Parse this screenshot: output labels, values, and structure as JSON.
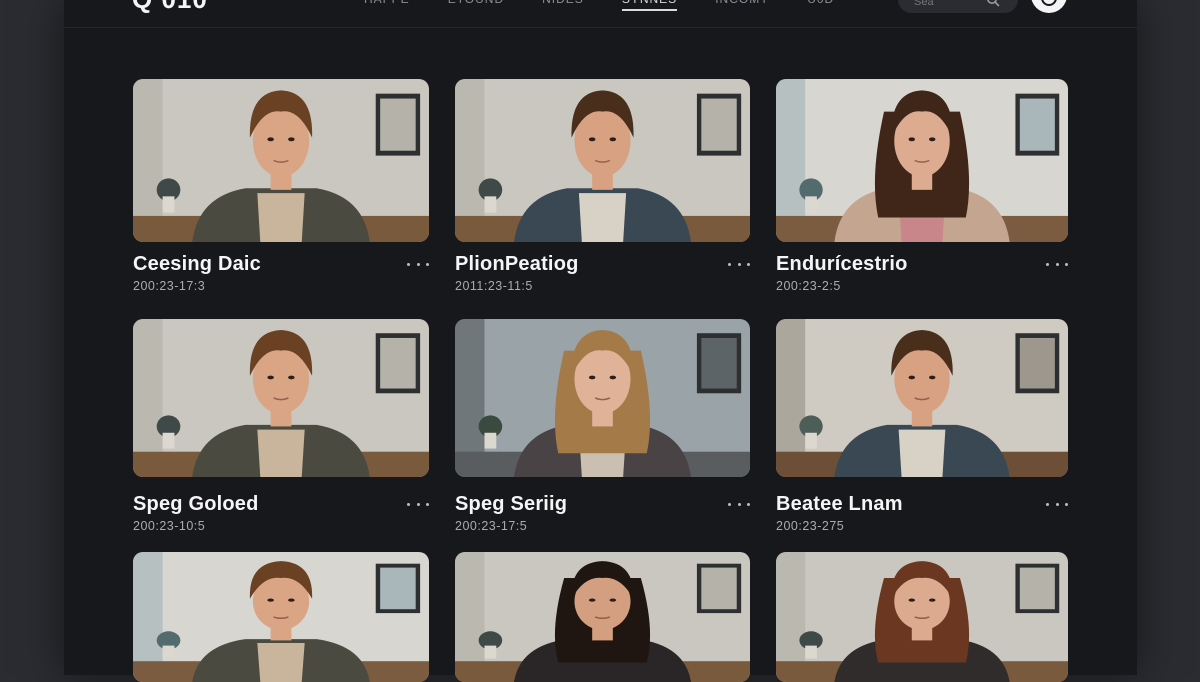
{
  "header": {
    "logo_text": "Q 010",
    "nav": [
      "HAPPE",
      "ETOUND",
      "NIDES",
      "SYNNES",
      "INCOMY",
      "U0D"
    ],
    "active_nav_index": 3,
    "search_placeholder": "Sea",
    "accent_color": "#f4f4f4"
  },
  "cards": [
    {
      "title": "Ceesing Daic",
      "date": "200:23-17:3",
      "person": "man-curly",
      "setting": "office"
    },
    {
      "title": "PlionPeatiog",
      "date": "2011:23-11:5",
      "person": "man-short",
      "setting": "office"
    },
    {
      "title": "Endurícestrio",
      "date": "200:23-2:5",
      "person": "woman-long",
      "setting": "window"
    },
    {
      "title": "Speg Goloed",
      "date": "200:23-10:5",
      "person": "man-curly",
      "setting": "office"
    },
    {
      "title": "Speg Seriig",
      "date": "200:23-17:5",
      "person": "woman-blonde",
      "setting": "street"
    },
    {
      "title": "Beatee Lnam",
      "date": "200:23-275",
      "person": "man-short",
      "setting": "cafe"
    },
    {
      "title": "",
      "date": "",
      "person": "man-curly",
      "setting": "window"
    },
    {
      "title": "",
      "date": "",
      "person": "woman-dark",
      "setting": "office"
    },
    {
      "title": "",
      "date": "",
      "person": "woman-auburn",
      "setting": "office"
    }
  ],
  "more_icon": "more-horizontal-icon"
}
